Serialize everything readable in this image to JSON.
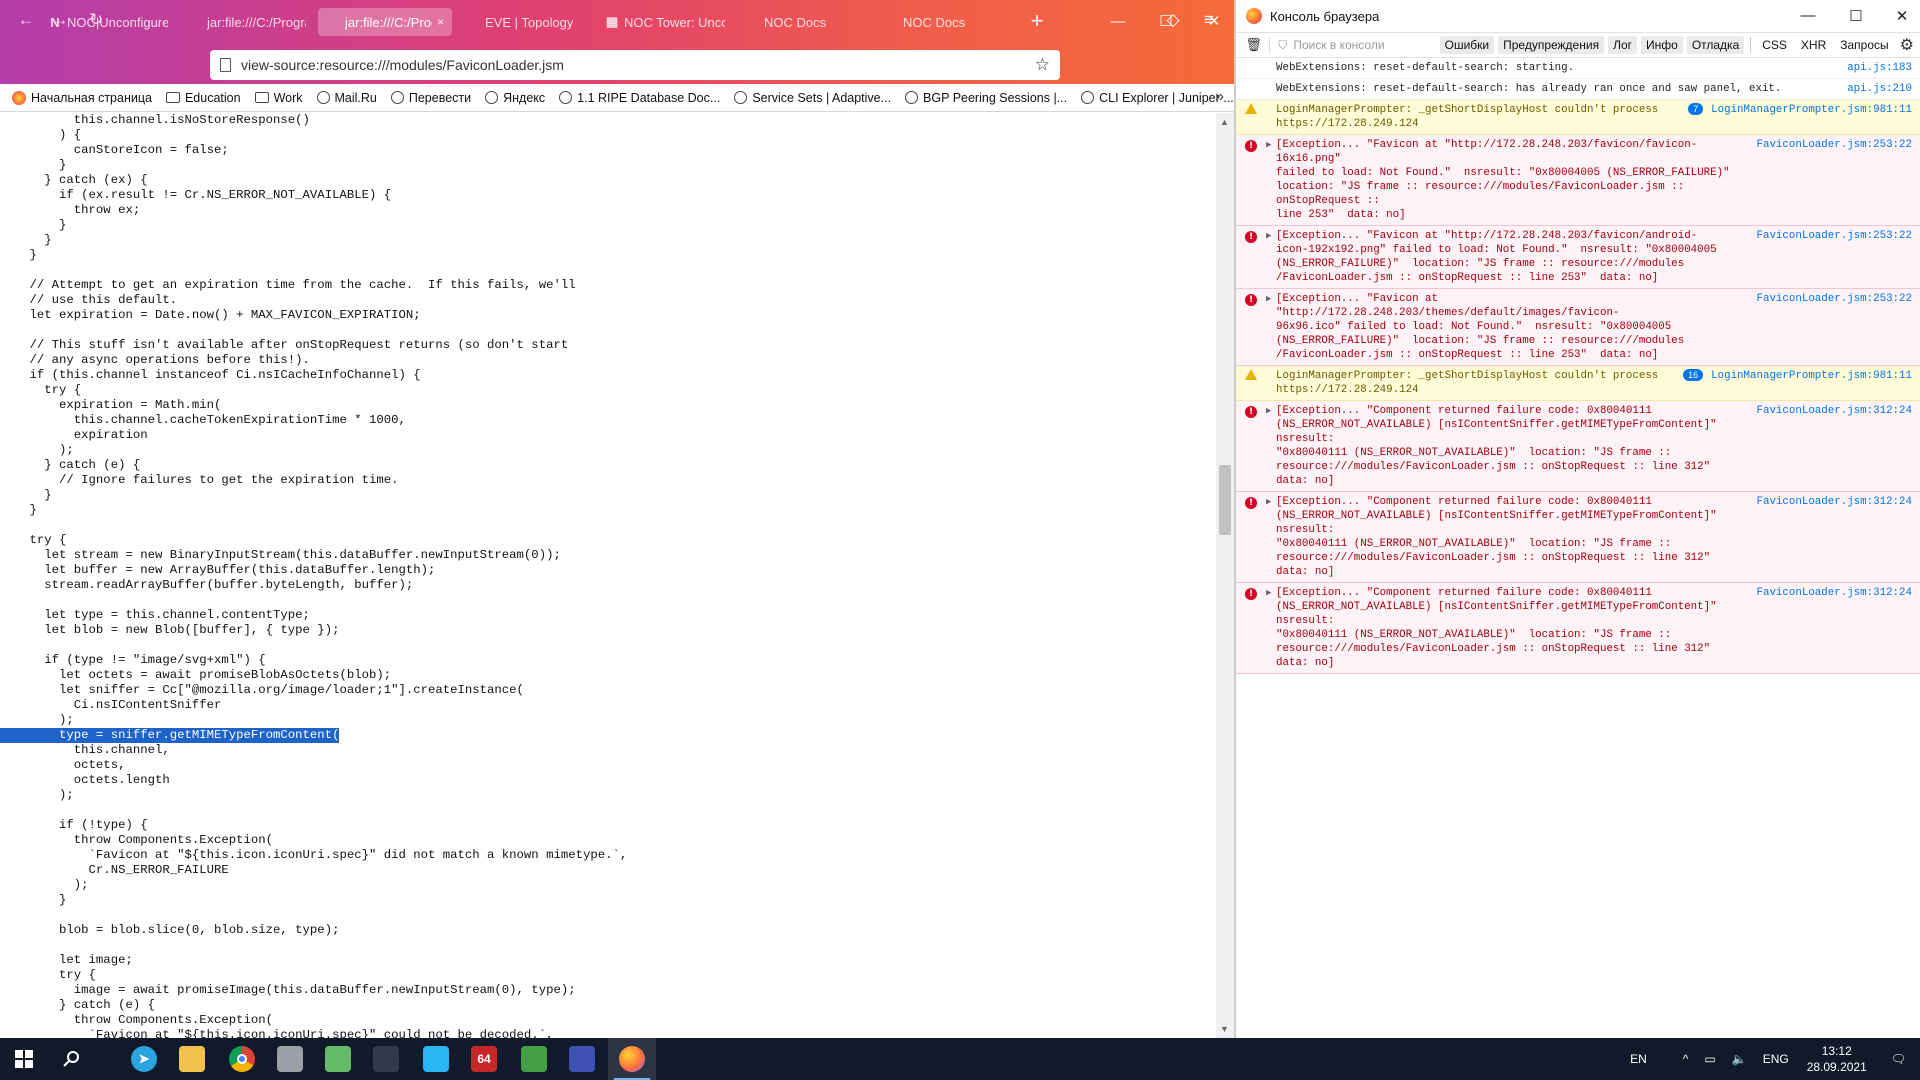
{
  "browser": {
    "tabs": [
      {
        "title": "NOC|Unconfigure",
        "icon": "N",
        "active": false
      },
      {
        "title": "jar:file:///C:/Program",
        "icon": "",
        "active": false
      },
      {
        "title": "jar:file:///C:/Progra",
        "icon": "",
        "active": true,
        "close": "×"
      },
      {
        "title": "EVE | Topology",
        "icon": "",
        "active": false
      },
      {
        "title": "NOC Tower: Unco",
        "icon": "▦",
        "active": false
      },
      {
        "title": "NOC Docs",
        "icon": "",
        "active": false
      },
      {
        "title": "NOC Docs",
        "icon": "",
        "active": false
      }
    ],
    "new_tab": "+",
    "window_controls": {
      "minimize": "—",
      "maximize": "☐",
      "close": "✕"
    },
    "nav": {
      "back": "←",
      "forward": "→",
      "reload": "↻"
    },
    "url": "view-source:resource:///modules/FaviconLoader.jsm",
    "star": "☆",
    "toolbar_icons": {
      "pocket": "◇",
      "menu": "≡"
    },
    "bookmarks": [
      {
        "label": "Начальная страница",
        "icon": "firefox"
      },
      {
        "label": "Education",
        "icon": "folder"
      },
      {
        "label": "Work",
        "icon": "folder"
      },
      {
        "label": "Mail.Ru",
        "icon": "globe"
      },
      {
        "label": "Перевести",
        "icon": "globe"
      },
      {
        "label": "Яндекс",
        "icon": "globe"
      },
      {
        "label": "1.1 RIPE Database Doc...",
        "icon": "globe"
      },
      {
        "label": "Service Sets | Adaptive...",
        "icon": "globe"
      },
      {
        "label": "BGP Peering Sessions |...",
        "icon": "globe"
      },
      {
        "label": "CLI Explorer | Juniper ...",
        "icon": "globe"
      }
    ],
    "bookmarks_more": "»"
  },
  "source_lines": [
    "          this.channel.isNoStoreResponse()",
    "        ) {",
    "          canStoreIcon = false;",
    "        }",
    "      } catch (ex) {",
    "        if (ex.result != Cr.NS_ERROR_NOT_AVAILABLE) {",
    "          throw ex;",
    "        }",
    "      }",
    "    }",
    "",
    "    // Attempt to get an expiration time from the cache.  If this fails, we'll",
    "    // use this default.",
    "    let expiration = Date.now() + MAX_FAVICON_EXPIRATION;",
    "",
    "    // This stuff isn't available after onStopRequest returns (so don't start",
    "    // any async operations before this!).",
    "    if (this.channel instanceof Ci.nsICacheInfoChannel) {",
    "      try {",
    "        expiration = Math.min(",
    "          this.channel.cacheTokenExpirationTime * 1000,",
    "          expiration",
    "        );",
    "      } catch (e) {",
    "        // Ignore failures to get the expiration time.",
    "      }",
    "    }",
    "",
    "    try {",
    "      let stream = new BinaryInputStream(this.dataBuffer.newInputStream(0));",
    "      let buffer = new ArrayBuffer(this.dataBuffer.length);",
    "      stream.readArrayBuffer(buffer.byteLength, buffer);",
    "",
    "      let type = this.channel.contentType;",
    "      let blob = new Blob([buffer], { type });",
    "",
    "      if (type != \"image/svg+xml\") {",
    "        let octets = await promiseBlobAsOctets(blob);",
    "        let sniffer = Cc[\"@mozilla.org/image/loader;1\"].createInstance(",
    "          Ci.nsIContentSniffer",
    "        );",
    "        type = sniffer.getMIMETypeFromContent(",
    "          this.channel,",
    "          octets,",
    "          octets.length",
    "        );",
    "",
    "        if (!type) {",
    "          throw Components.Exception(",
    "            `Favicon at \"${this.icon.iconUri.spec}\" did not match a known mimetype.`,",
    "            Cr.NS_ERROR_FAILURE",
    "          );",
    "        }",
    "",
    "        blob = blob.slice(0, blob.size, type);",
    "",
    "        let image;",
    "        try {",
    "          image = await promiseImage(this.dataBuffer.newInputStream(0), type);",
    "        } catch (e) {",
    "          throw Components.Exception(",
    "            `Favicon at \"${this.icon.iconUri.spec}\" could not be decoded.`,"
  ],
  "selected_line_index": 41,
  "console": {
    "title": "Консоль браузера",
    "window_controls": {
      "minimize": "—",
      "maximize": "☐",
      "close": "✕"
    },
    "filter_placeholder": "Поиск в консоли",
    "filters": [
      "Ошибки",
      "Предупреждения",
      "Лог",
      "Инфо",
      "Отладка"
    ],
    "filters2": [
      "CSS",
      "XHR",
      "Запросы"
    ],
    "messages": [
      {
        "level": "log",
        "text": "WebExtensions: reset-default-search: starting.",
        "source": "api.js:183"
      },
      {
        "level": "log",
        "text": "WebExtensions: reset-default-search: has already ran once and saw panel, exit.",
        "source": "api.js:210"
      },
      {
        "level": "warn",
        "text": "LoginManagerPrompter: _getShortDisplayHost couldn't process\nhttps://172.28.249.124",
        "count": "7",
        "source": "LoginManagerPrompter.jsm:981:11"
      },
      {
        "level": "error",
        "text": "[Exception... \"Favicon at \"http://172.28.248.203/favicon/favicon-16x16.png\"\nfailed to load: Not Found.\"  nsresult: \"0x80004005 (NS_ERROR_FAILURE)\"\nlocation: \"JS frame :: resource:///modules/FaviconLoader.jsm :: onStopRequest ::\nline 253\"  data: no]",
        "source": "FaviconLoader.jsm:253:22"
      },
      {
        "level": "error",
        "text": "[Exception... \"Favicon at \"http://172.28.248.203/favicon/android-\nicon-192x192.png\" failed to load: Not Found.\"  nsresult: \"0x80004005\n(NS_ERROR_FAILURE)\"  location: \"JS frame :: resource:///modules\n/FaviconLoader.jsm :: onStopRequest :: line 253\"  data: no]",
        "source": "FaviconLoader.jsm:253:22"
      },
      {
        "level": "error",
        "text": "[Exception... \"Favicon at \"http://172.28.248.203/themes/default/images/favicon-\n96x96.ico\" failed to load: Not Found.\"  nsresult: \"0x80004005\n(NS_ERROR_FAILURE)\"  location: \"JS frame :: resource:///modules\n/FaviconLoader.jsm :: onStopRequest :: line 253\"  data: no]",
        "source": "FaviconLoader.jsm:253:22"
      },
      {
        "level": "warn",
        "text": "LoginManagerPrompter: _getShortDisplayHost couldn't process\nhttps://172.28.249.124",
        "count": "16",
        "source": "LoginManagerPrompter.jsm:981:11"
      },
      {
        "level": "error",
        "text": "[Exception... \"Component returned failure code: 0x80040111\n(NS_ERROR_NOT_AVAILABLE) [nsIContentSniffer.getMIMETypeFromContent]\"  nsresult:\n\"0x80040111 (NS_ERROR_NOT_AVAILABLE)\"  location: \"JS frame ::\nresource:///modules/FaviconLoader.jsm :: onStopRequest :: line 312\"  data: no]",
        "source": "FaviconLoader.jsm:312:24"
      },
      {
        "level": "error",
        "text": "[Exception... \"Component returned failure code: 0x80040111\n(NS_ERROR_NOT_AVAILABLE) [nsIContentSniffer.getMIMETypeFromContent]\"  nsresult:\n\"0x80040111 (NS_ERROR_NOT_AVAILABLE)\"  location: \"JS frame ::\nresource:///modules/FaviconLoader.jsm :: onStopRequest :: line 312\"  data: no]",
        "source": "FaviconLoader.jsm:312:24"
      },
      {
        "level": "error",
        "text": "[Exception... \"Component returned failure code: 0x80040111\n(NS_ERROR_NOT_AVAILABLE) [nsIContentSniffer.getMIMETypeFromContent]\"  nsresult:\n\"0x80040111 (NS_ERROR_NOT_AVAILABLE)\"  location: \"JS frame ::\nresource:///modules/FaviconLoader.jsm :: onStopRequest :: line 312\"  data: no]",
        "source": "FaviconLoader.jsm:312:24"
      }
    ]
  },
  "taskbar": {
    "apps": [
      {
        "name": "start-icon",
        "label": "",
        "color": "#101a2b",
        "active": false
      },
      {
        "name": "search-icon",
        "label": "",
        "color": "#101a2b",
        "active": false
      },
      {
        "name": "telegram-icon",
        "label": "",
        "color": "#2aa3df",
        "active": false
      },
      {
        "name": "file-explorer-icon",
        "label": "",
        "color": "#f2c14e",
        "active": false
      },
      {
        "name": "chrome-icon",
        "label": "",
        "color": "#4caf50",
        "active": false
      },
      {
        "name": "wireshark-icon",
        "label": "",
        "color": "#9aa0a6",
        "active": false
      },
      {
        "name": "notepad-icon",
        "label": "",
        "color": "#66bb6a",
        "active": false
      },
      {
        "name": "terminal-icon",
        "label": "",
        "color": "#303a4a",
        "active": false
      },
      {
        "name": "app-building-icon",
        "label": "",
        "color": "#29b6f6",
        "active": false
      },
      {
        "name": "app-64-icon",
        "label": "64",
        "color": "#c62828",
        "active": false
      },
      {
        "name": "utorrent-icon",
        "label": "",
        "color": "#43a047",
        "active": false
      },
      {
        "name": "network-app-icon",
        "label": "",
        "color": "#3f51b5",
        "active": false
      },
      {
        "name": "firefox-icon",
        "label": "",
        "color": "#ff7139",
        "active": true
      }
    ],
    "lang_indicator": "EN",
    "tray_arrow": "^",
    "keyboard_lang": "ENG",
    "time": "13:12",
    "date": "28.09.2021",
    "notifications": "🗨"
  }
}
